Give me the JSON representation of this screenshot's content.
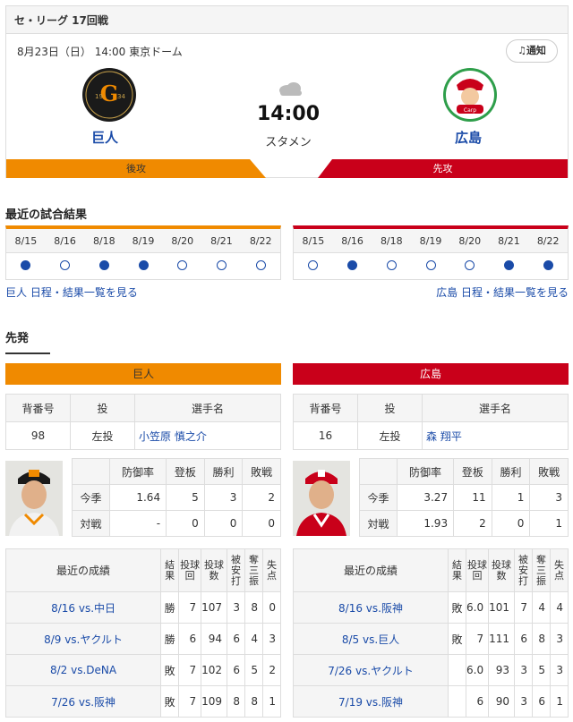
{
  "game": {
    "league": "セ・リーグ 17回戦",
    "datetime": "8月23日（日） 14:00 東京ドーム",
    "notify_label": "通知",
    "time": "14:00",
    "status": "スタメン",
    "home": {
      "name": "巨人",
      "order": "後攻",
      "color": "#f08a00",
      "logo": "giants-logo"
    },
    "away": {
      "name": "広島",
      "order": "先攻",
      "color": "#c9001a",
      "logo": "carp-logo"
    }
  },
  "recent": {
    "title": "最近の試合結果",
    "home": {
      "dates": [
        "8/15",
        "8/16",
        "8/18",
        "8/19",
        "8/20",
        "8/21",
        "8/22"
      ],
      "results": [
        "win",
        "loss",
        "win",
        "win",
        "loss",
        "loss",
        "loss"
      ],
      "link": "巨人 日程・結果一覧を見る"
    },
    "away": {
      "dates": [
        "8/15",
        "8/16",
        "8/18",
        "8/19",
        "8/20",
        "8/21",
        "8/22"
      ],
      "results": [
        "loss",
        "win",
        "loss",
        "loss",
        "loss",
        "win",
        "win"
      ],
      "link": "広島 日程・結果一覧を見る"
    }
  },
  "starters": {
    "title": "先発",
    "pitcher_headers": [
      "背番号",
      "投",
      "選手名"
    ],
    "stat_headers": [
      "防御率",
      "登板",
      "勝利",
      "敗戦"
    ],
    "result_headers": [
      "最近の成績",
      "結果",
      "投球回",
      "投球数",
      "被安打",
      "奪三振",
      "失点"
    ],
    "home": {
      "team": "巨人",
      "pitcher": {
        "number": "98",
        "throws": "左投",
        "name": "小笠原 慎之介"
      },
      "season": {
        "label": "今季",
        "era": "1.64",
        "games": "5",
        "wins": "3",
        "losses": "2"
      },
      "vs": {
        "label": "対戦",
        "era": "-",
        "games": "0",
        "wins": "0",
        "losses": "0"
      },
      "results": [
        {
          "game": "8/16 vs.中日",
          "result": "勝",
          "ip": "7",
          "pitches": "107",
          "hits": "3",
          "so": "8",
          "runs": "0"
        },
        {
          "game": "8/9 vs.ヤクルト",
          "result": "勝",
          "ip": "6",
          "pitches": "94",
          "hits": "6",
          "so": "4",
          "runs": "3"
        },
        {
          "game": "8/2 vs.DeNA",
          "result": "敗",
          "ip": "7",
          "pitches": "102",
          "hits": "6",
          "so": "5",
          "runs": "2"
        },
        {
          "game": "7/26 vs.阪神",
          "result": "敗",
          "ip": "7",
          "pitches": "109",
          "hits": "8",
          "so": "8",
          "runs": "1"
        }
      ]
    },
    "away": {
      "team": "広島",
      "pitcher": {
        "number": "16",
        "throws": "左投",
        "name": "森 翔平"
      },
      "season": {
        "label": "今季",
        "era": "3.27",
        "games": "11",
        "wins": "1",
        "losses": "3"
      },
      "vs": {
        "label": "対戦",
        "era": "1.93",
        "games": "2",
        "wins": "0",
        "losses": "1"
      },
      "results": [
        {
          "game": "8/16 vs.阪神",
          "result": "敗",
          "ip": "6.0",
          "pitches": "101",
          "hits": "7",
          "so": "4",
          "runs": "4"
        },
        {
          "game": "8/5 vs.巨人",
          "result": "敗",
          "ip": "7",
          "pitches": "111",
          "hits": "6",
          "so": "8",
          "runs": "3"
        },
        {
          "game": "7/26 vs.ヤクルト",
          "result": "",
          "ip": "6.0",
          "pitches": "93",
          "hits": "3",
          "so": "5",
          "runs": "3"
        },
        {
          "game": "7/19 vs.阪神",
          "result": "",
          "ip": "6",
          "pitches": "90",
          "hits": "3",
          "so": "6",
          "runs": "1"
        }
      ]
    }
  }
}
